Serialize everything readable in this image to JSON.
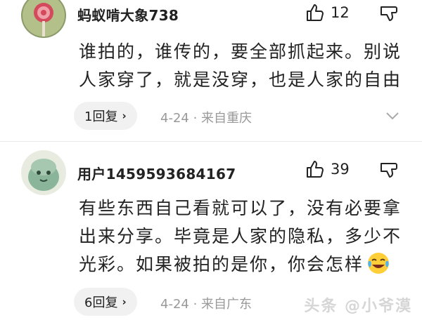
{
  "comments": [
    {
      "username": "蚂蚁啃大象738",
      "avatar_icon": "lollipop-avatar-icon",
      "like_count": "12",
      "lines": [
        "谁拍的，谁传的，要全部抓起来。别说",
        "人家穿了，就是没穿，也是人家的自由"
      ],
      "reply_label": "1回复",
      "reply_chevron": "›",
      "date": "4-24 · 来自重庆"
    },
    {
      "username": "用户1459593684167",
      "avatar_icon": "green-cartoon-avatar-icon",
      "like_count": "39",
      "lines": [
        "有些东西自己看就可以了，没有必要拿",
        "出来分享。毕竟是人家的隐私，多少不",
        "光彩。如果被拍的是你，你会怎样"
      ],
      "emoji": "crying-laughing-emoji-icon",
      "reply_label": "6回复",
      "reply_chevron": "›",
      "date": "4-24 · 来自广东"
    }
  ],
  "watermark": {
    "text": "头条 @小爷漠",
    "icon": "watermark-logo"
  },
  "colors": {
    "meta": "#999999",
    "pill_bg": "#f1f1f1",
    "text": "#222222"
  }
}
